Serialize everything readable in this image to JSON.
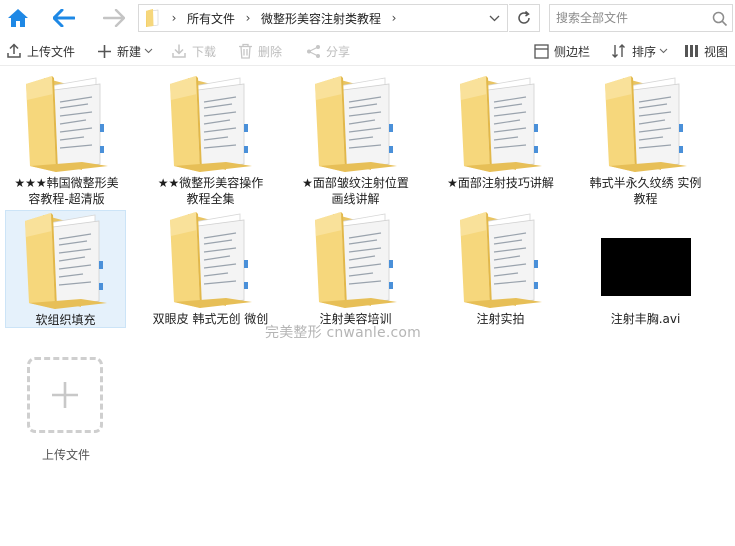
{
  "address": {
    "breadcrumbs": [
      "所有文件",
      "微整形美容注射类教程"
    ]
  },
  "search": {
    "placeholder": "搜索全部文件"
  },
  "toolbar": {
    "upload_label": "上传文件",
    "new_label": "新建",
    "download_label": "下载",
    "delete_label": "删除",
    "share_label": "分享",
    "sidebar_label": "侧边栏",
    "sort_label": "排序",
    "view_label": "视图"
  },
  "files": [
    {
      "name": "★★★韩国微整形美容教程-超清版",
      "type": "folder"
    },
    {
      "name": "★★微整形美容操作教程全集",
      "type": "folder"
    },
    {
      "name": "★面部皱纹注射位置画线讲解",
      "type": "folder"
    },
    {
      "name": "★面部注射技巧讲解",
      "type": "folder"
    },
    {
      "name": "韩式半永久纹绣 实例教程",
      "type": "folder"
    },
    {
      "name": "软组织填充",
      "type": "folder",
      "selected": true
    },
    {
      "name": "双眼皮 韩式无创 微创",
      "type": "folder"
    },
    {
      "name": "注射美容培训",
      "type": "folder"
    },
    {
      "name": "注射实拍",
      "type": "folder"
    },
    {
      "name": "注射丰胸.avi",
      "type": "video"
    }
  ],
  "upload_tile_label": "上传文件",
  "watermark": "完美整形 cnwanle.com",
  "colors": {
    "accent": "#1e88e5",
    "folder_main": "#f6d77c",
    "folder_dark": "#e2b84a",
    "selection_bg": "#e5f1fb",
    "selection_border": "#cce4f7"
  }
}
